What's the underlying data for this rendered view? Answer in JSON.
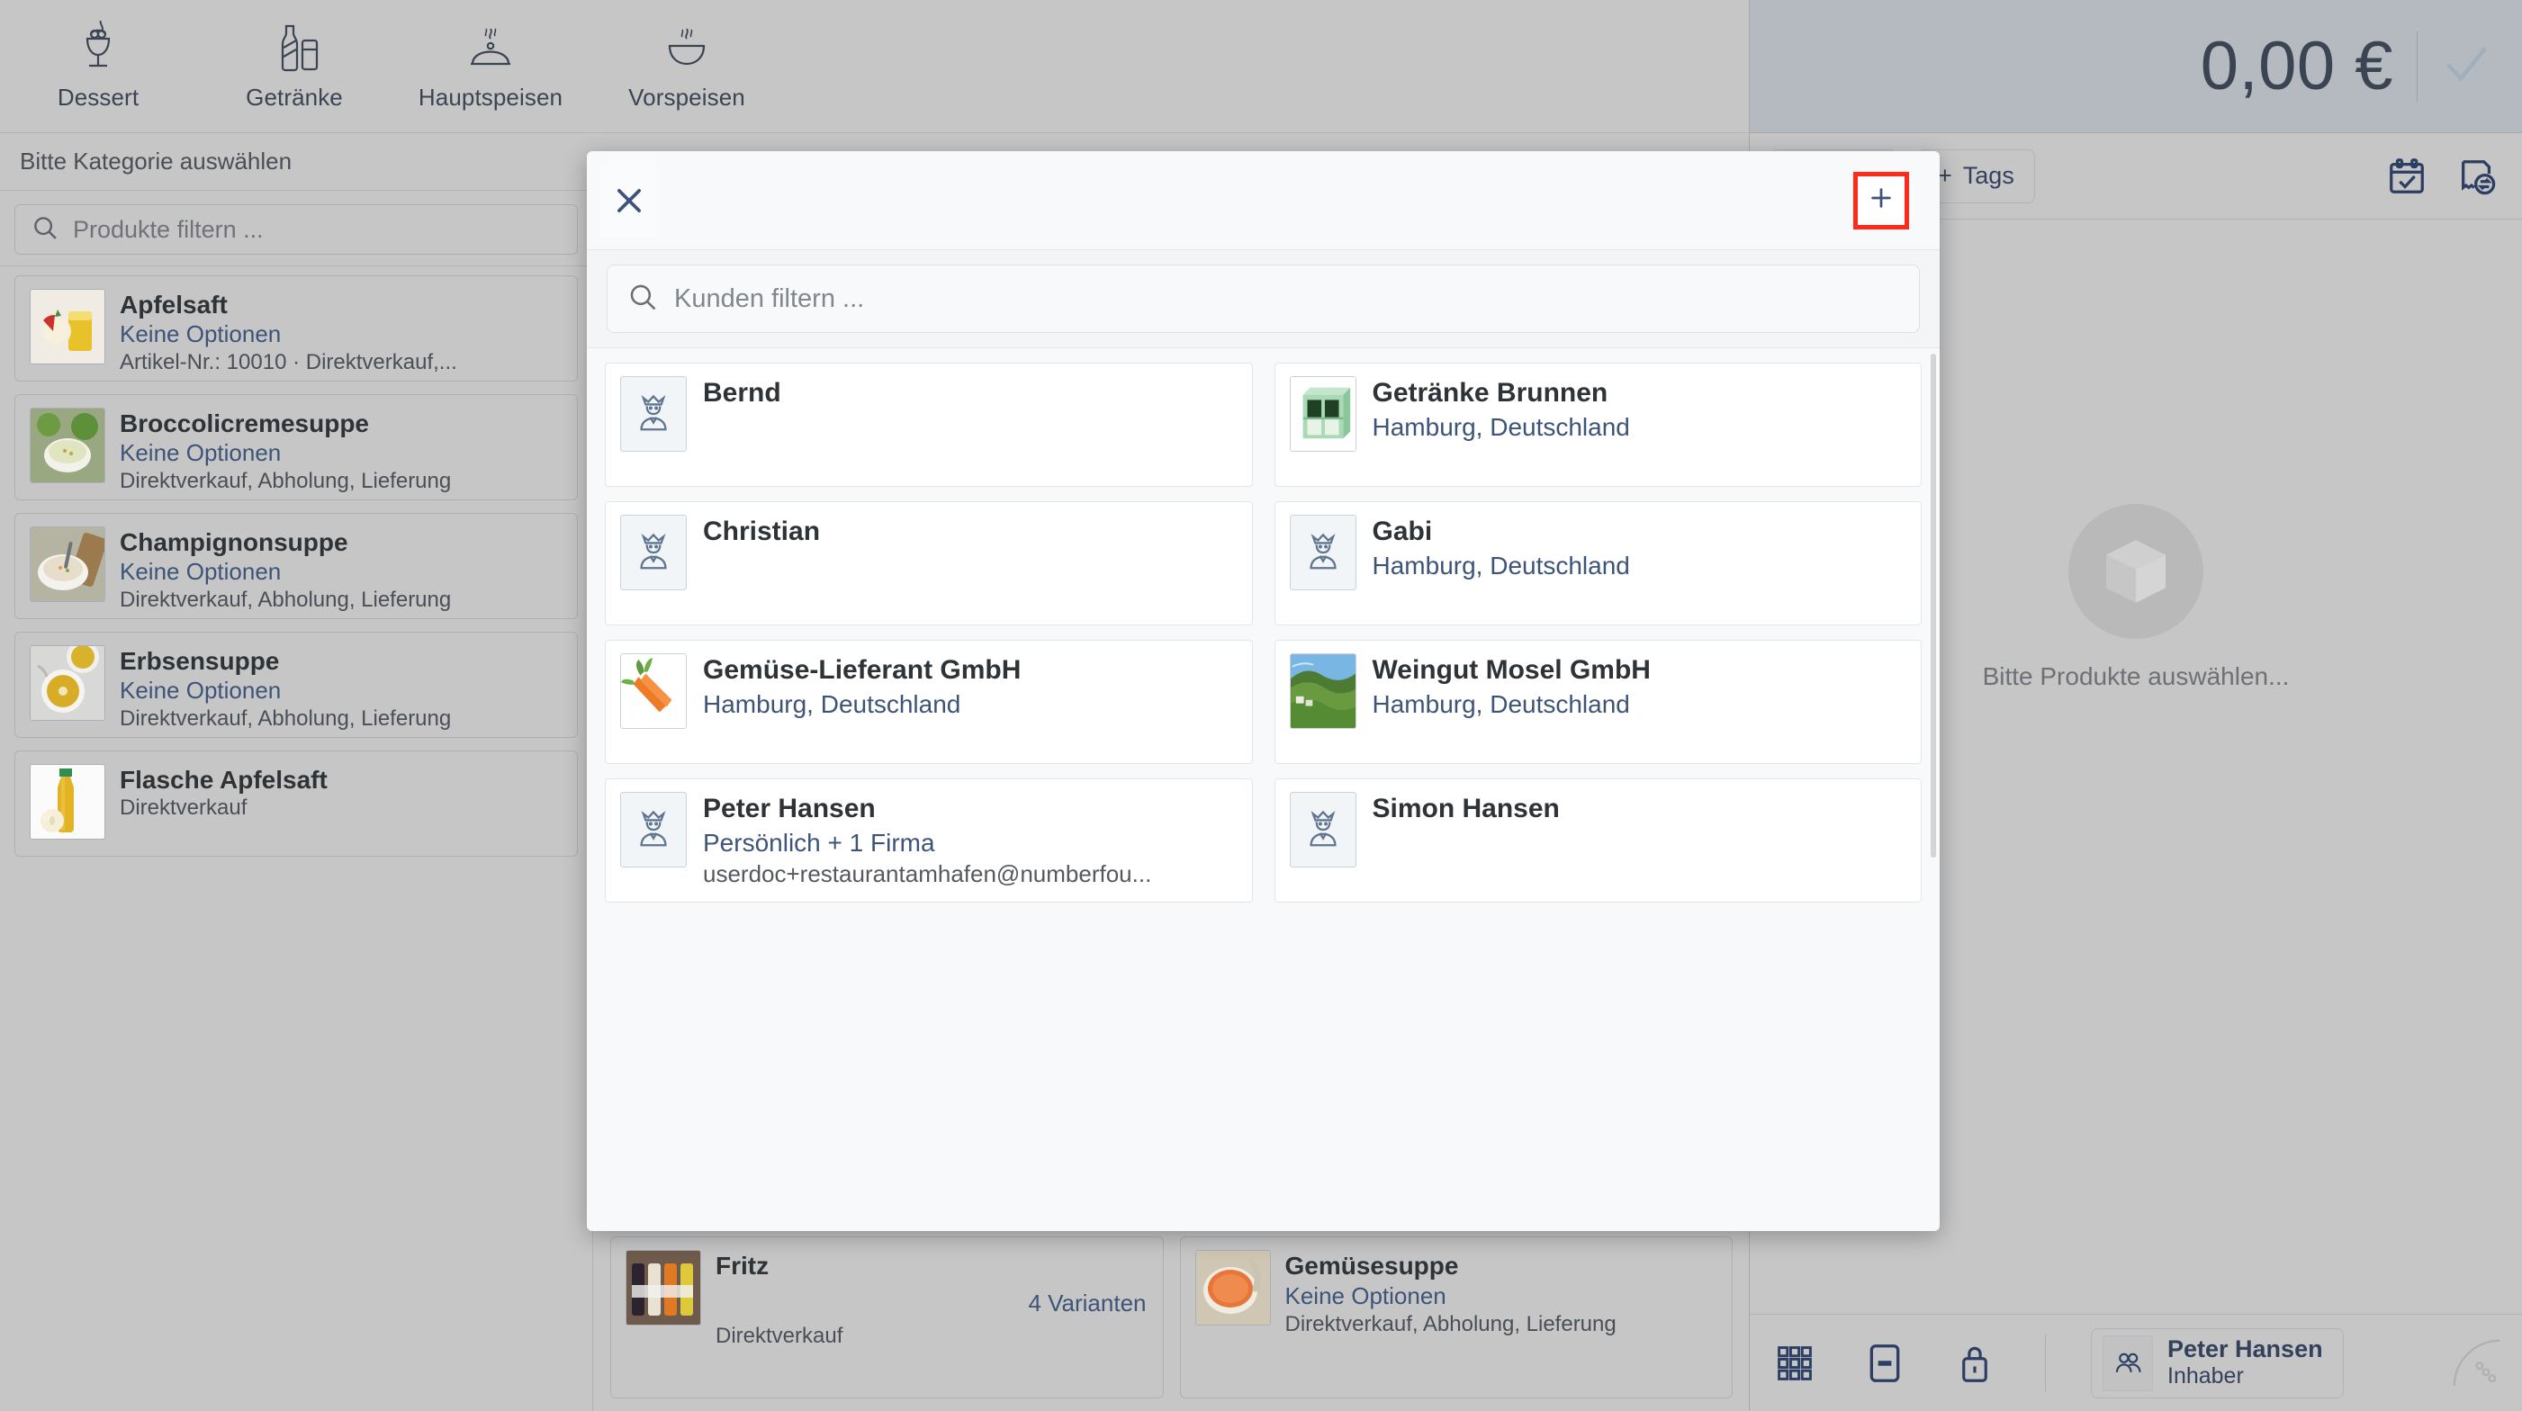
{
  "categories": [
    {
      "label": "Dessert",
      "icon": "dessert-icon"
    },
    {
      "label": "Getränke",
      "icon": "drinks-icon"
    },
    {
      "label": "Hauptspeisen",
      "icon": "main-dish-icon"
    },
    {
      "label": "Vorspeisen",
      "icon": "starters-icon"
    }
  ],
  "category_hint": "Bitte Kategorie auswählen",
  "product_filter": {
    "placeholder": "Produkte filtern  ..."
  },
  "products": [
    {
      "name": "Apfelsaft",
      "options": "Keine Optionen",
      "sub": "Artikel-Nr.: 10010 · Direktverkauf,...",
      "thumb": "apple-juice"
    },
    {
      "name": "Broccolicremesuppe",
      "options": "Keine Optionen",
      "sub": "Direktverkauf, Abholung, Lieferung",
      "thumb": "broccoli-soup"
    },
    {
      "name": "Champignonsuppe",
      "options": "Keine Optionen",
      "sub": "Direktverkauf, Abholung, Lieferung",
      "thumb": "mushroom-soup"
    },
    {
      "name": "Erbsensuppe",
      "options": "Keine Optionen",
      "sub": "Direktverkauf, Abholung, Lieferung",
      "thumb": "pea-soup"
    },
    {
      "name": "Flasche Apfelsaft",
      "options": "",
      "sub": "Direktverkauf",
      "thumb": "juice-bottle"
    }
  ],
  "product_grid": [
    {
      "name": "Fritz",
      "options": "",
      "variants": "4 Varianten",
      "sub": "Direktverkauf",
      "thumb": "bottles"
    },
    {
      "name": "Gemüsesuppe",
      "options": "Keine Optionen",
      "variants": "",
      "sub": "Direktverkauf, Abholung, Lieferung",
      "thumb": "veg-soup"
    }
  ],
  "order": {
    "total": "0,00 €",
    "confirm_icon": "check-icon",
    "tags_label": "Tags",
    "tags_plus": "+",
    "toolbar_icons": [
      "calendar-check-icon",
      "receipt-return-icon"
    ],
    "empty_text": "Bitte Produkte auswählen...",
    "empty_icon": "cube-icon"
  },
  "bottom_bar": {
    "icons": [
      "grid-keypad-icon",
      "minus-box-icon",
      "lock-icon"
    ],
    "user_name": "Peter Hansen",
    "user_role": "Inhaber",
    "user_icon": "users-icon",
    "more_icon": "dots-arc-icon"
  },
  "modal": {
    "close_icon": "close-icon",
    "add_icon": "plus-icon",
    "search": {
      "placeholder": "Kunden filtern  ...",
      "icon": "search-icon"
    },
    "customers": [
      {
        "name": "Bernd",
        "sub": "",
        "mail": "",
        "thumb": "avatar-crown"
      },
      {
        "name": "Getränke Brunnen",
        "sub": "Hamburg, Deutschland",
        "mail": "",
        "thumb": "crate"
      },
      {
        "name": "Christian",
        "sub": "",
        "mail": "",
        "thumb": "avatar-crown"
      },
      {
        "name": "Gabi",
        "sub": "Hamburg, Deutschland",
        "mail": "",
        "thumb": "avatar-crown"
      },
      {
        "name": "Gemüse-Lieferant GmbH",
        "sub": "Hamburg, Deutschland",
        "mail": "",
        "thumb": "carrots"
      },
      {
        "name": "Weingut Mosel GmbH",
        "sub": "Hamburg, Deutschland",
        "mail": "",
        "thumb": "vineyard"
      },
      {
        "name": "Peter Hansen",
        "sub": "Persönlich + 1 Firma",
        "mail": "userdoc+restaurantamhafen@numberfou...",
        "thumb": "avatar-crown"
      },
      {
        "name": "Simon Hansen",
        "sub": "",
        "mail": "",
        "thumb": "avatar-crown"
      }
    ]
  },
  "colors": {
    "app_bg": "#c6c6c6",
    "accent_blue": "#3d5478",
    "highlight_red": "#ff2a17",
    "panel_header": "#b4babf"
  }
}
